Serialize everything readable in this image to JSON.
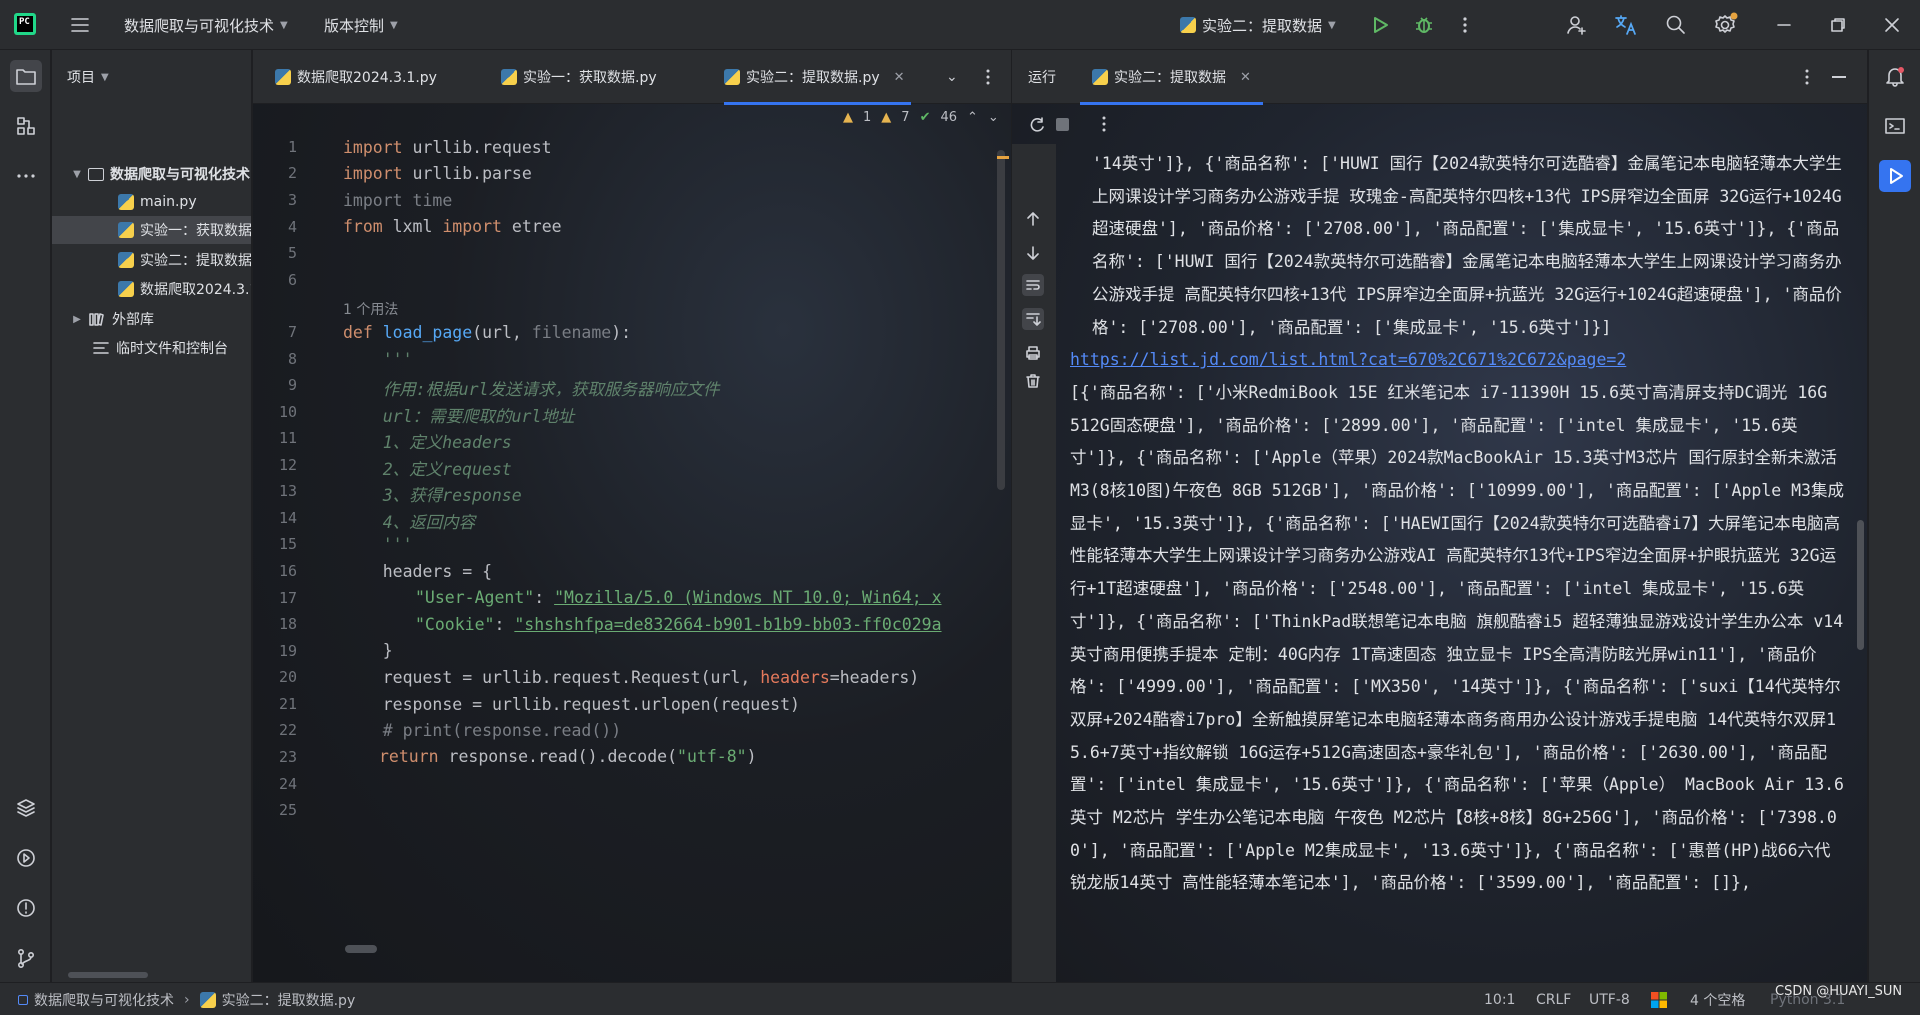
{
  "title_bar": {
    "project_name": "数据爬取与可视化技术",
    "vcs_label": "版本控制",
    "run_config": "实验二：提取数据"
  },
  "project_panel": {
    "title": "项目",
    "root": "数据爬取与可视化技术",
    "files": [
      "main.py",
      "实验一：获取数据.py",
      "实验二：提取数据.py",
      "数据爬取2024.3.1.py"
    ],
    "external": "外部库",
    "scratches": "临时文件和控制台"
  },
  "editor": {
    "tabs": [
      "数据爬取2024.3.1.py",
      "实验一：获取数据.py",
      "实验二：提取数据.py"
    ],
    "inspections": {
      "warnings": "1",
      "weak": "7",
      "typos": "46"
    },
    "usages_hint": "1 个用法",
    "line_numbers": [
      "1",
      "2",
      "3",
      "4",
      "5",
      "6",
      "7",
      "8",
      "9",
      "10",
      "11",
      "12",
      "13",
      "14",
      "15",
      "16",
      "17",
      "18",
      "19",
      "20",
      "21",
      "22",
      "23",
      "24",
      "25"
    ],
    "code": {
      "l1_kw": "import",
      "l1_rest": " urllib.request",
      "l2_kw": "import",
      "l2_rest": " urllib.parse",
      "l3": "import time",
      "l4_kw1": "from",
      "l4_mid": " lxml ",
      "l4_kw2": "import",
      "l4_rest": " etree",
      "l7_kw": "def",
      "l7_fn": "load_page",
      "l7_a": "(url, ",
      "l7_b": "filename",
      "l7_c": "):",
      "l8": "    '''",
      "l9": "    作用:根据url发送请求，获取服务器响应文件",
      "l10": "    url：需要爬取的url地址",
      "l11": "    1、定义headers",
      "l12": "    2、定义request",
      "l13": "    3、获得response",
      "l14": "    4、返回内容",
      "l15": "    '''",
      "l16": "    headers = {",
      "l17_k": "\"User-Agent\"",
      "l17_v": "\"Mozilla/5.0 (Windows NT 10.0; Win64; x",
      "l18_k": "\"Cookie\"",
      "l18_v": "\"shshshfpa=de832664-b901-b1b9-bb03-ff0c029a",
      "l19": "    }",
      "l20_a": "    request = urllib.request.Request(url, ",
      "l20_p": "headers",
      "l20_b": "=headers)",
      "l21": "    response = urllib.request.urlopen(request)",
      "l22": "    # print(response.read())",
      "l23_kw": "return",
      "l23_a": " response.read().decode(",
      "l23_s": "\"utf-8\"",
      "l23_b": ")"
    }
  },
  "run_panel": {
    "label": "运行",
    "tab": "实验二：提取数据",
    "output_top": "'14英寸']}, {'商品名称': ['HUWI 国行【2024款英特尔可选酷睿】金属笔记本电脑轻薄本大学生上网课设计学习商务办公游戏手提 玫瑰金-高配英特尔四核+13代 IPS屏窄边全面屏 32G运行+1024G超速硬盘'], '商品价格': ['2708.00'], '商品配置': ['集成显卡', '15.6英寸']}, {'商品名称': ['HUWI 国行【2024款英特尔可选酷睿】金属笔记本电脑轻薄本大学生上网课设计学习商务办公游戏手提 高配英特尔四核+13代 IPS屏窄边全面屏+抗蓝光 32G运行+1024G超速硬盘'], '商品价格': ['2708.00'], '商品配置': ['集成显卡', '15.6英寸']}]",
    "url": "https://list.jd.com/list.html?cat=670%2C671%2C672&page=2",
    "output_bottom": "[{'商品名称': ['小米RedmiBook 15E 红米笔记本 i7-11390H 15.6英寸高清屏支持DC调光 16G 512G固态硬盘'], '商品价格': ['2899.00'], '商品配置': ['intel 集成显卡', '15.6英寸']}, {'商品名称': ['Apple（苹果）2024款MacBookAir 15.3英寸M3芯片 国行原封全新未激活 M3(8核10图)午夜色 8GB 512GB'], '商品价格': ['10999.00'], '商品配置': ['Apple M3集成显卡', '15.3英寸']}, {'商品名称': ['HAEWI国行【2024款英特尔可选酷睿i7】大屏笔记本电脑高性能轻薄本大学生上网课设计学习商务办公游戏AI 高配英特尔13代+IPS窄边全面屏+护眼抗蓝光 32G运行+1T超速硬盘'], '商品价格': ['2548.00'], '商品配置': ['intel 集成显卡', '15.6英寸']}, {'商品名称': ['ThinkPad联想笔记本电脑 旗舰酷睿i5 超轻薄独显游戏设计学生办公本 v14英寸商用便携手提本 定制：40G内存 1T高速固态 独立显卡 IPS全高清防眩光屏win11'], '商品价格': ['4999.00'], '商品配置': ['MX350', '14英寸']}, {'商品名称': ['suxi【14代英特尔双屏+2024酷睿i7pro】全新触摸屏笔记本电脑轻薄本商务商用办公设计游戏手提电脑 14代英特尔双屏15.6+7英寸+指纹解锁 16G运存+512G高速固态+豪华礼包'], '商品价格': ['2630.00'], '商品配置': ['intel 集成显卡', '15.6英寸']}, {'商品名称': ['苹果（Apple） MacBook Air 13.6英寸 M2芯片 学生办公笔记本电脑 午夜色 M2芯片【8核+8核】8G+256G'], '商品价格': ['7398.00'], '商品配置': ['Apple M2集成显卡', '13.6英寸']}, {'商品名称': ['惠普(HP)战66六代锐龙版14英寸 高性能轻薄本笔记本'], '商品价格': ['3599.00'], '商品配置': []},"
  },
  "status_bar": {
    "breadcrumb_project": "数据爬取与可视化技术",
    "breadcrumb_file": "实验二：提取数据.py",
    "position": "10:1",
    "line_sep": "CRLF",
    "encoding": "UTF-8",
    "indent": "4 个空格",
    "interpreter": "Python 3.1",
    "watermark": "CSDN @HUAYI_SUN"
  },
  "colors": {
    "accent": "#3574f0",
    "run_green": "#5fb865",
    "debug_green": "#5fb865"
  }
}
